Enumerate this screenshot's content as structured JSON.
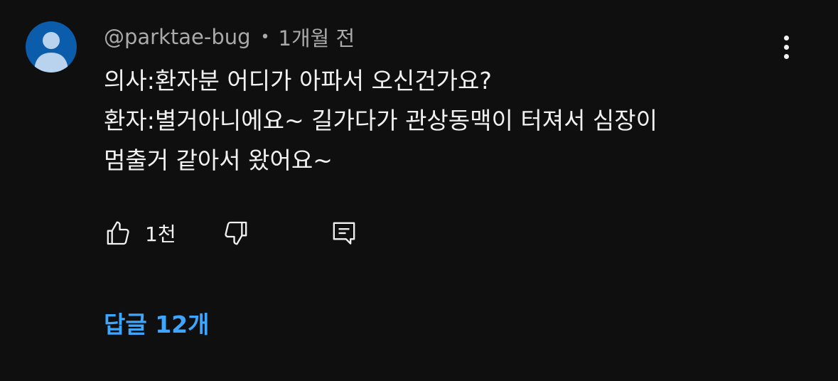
{
  "comment": {
    "author": "@parktae-bug",
    "separator": "•",
    "time_ago": "1개월 전",
    "lines": [
      "의사:환자분 어디가 아파서 오신건가요?",
      "환자:별거아니에요~ 길가다가 관상동맥이 터져서 심장이",
      "멈출거 같아서 왔어요~"
    ]
  },
  "actions": {
    "like_icon": "thumbs-up-icon",
    "like_count": "1천",
    "dislike_icon": "thumbs-down-icon",
    "reply_icon": "comment-reply-icon"
  },
  "replies": {
    "label": "답글 12개"
  },
  "colors": {
    "background": "#0f0f0f",
    "primary_text": "#f1f1f1",
    "secondary_text": "#aaaaaa",
    "link": "#3ea6ff",
    "avatar": "#0b5cab"
  }
}
